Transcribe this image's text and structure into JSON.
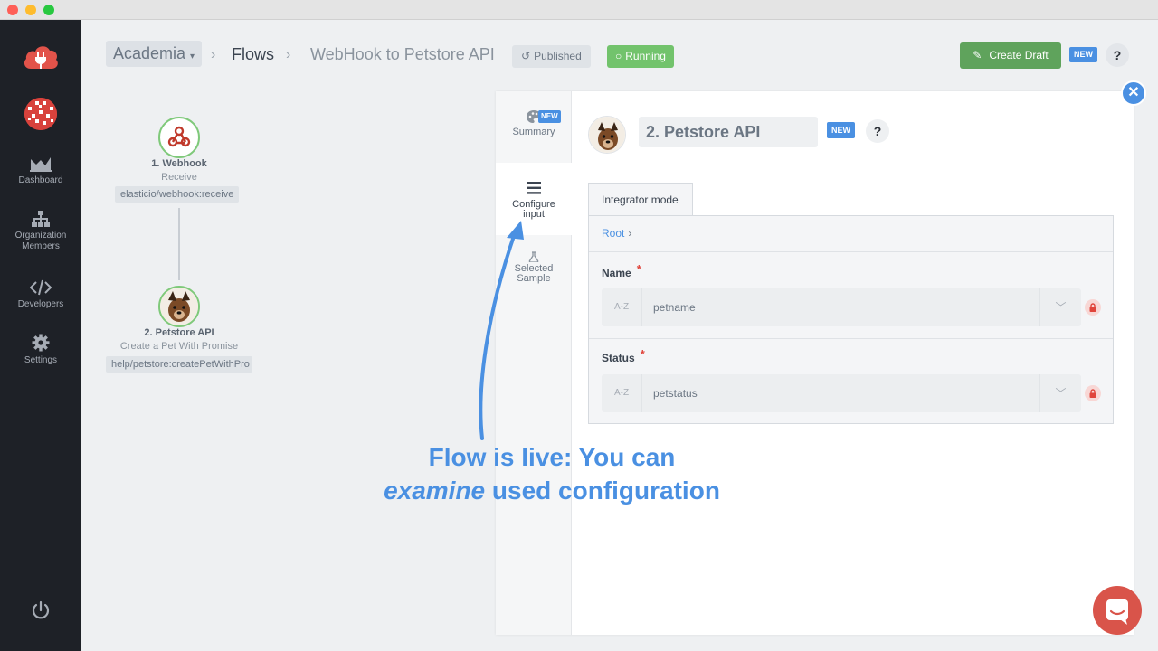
{
  "window": {
    "dots": [
      "#fe5f57",
      "#febc2e",
      "#28c840"
    ]
  },
  "sidebar": {
    "items": [
      {
        "label": "Dashboard",
        "icon": "dashboard-icon"
      },
      {
        "label": "Organization Members",
        "icon": "org-chart-icon"
      },
      {
        "label": "Developers",
        "icon": "code-icon"
      },
      {
        "label": "Settings",
        "icon": "gear-icon"
      }
    ],
    "brand_color": "#e2534a"
  },
  "header": {
    "org": "Academia",
    "flows_label": "Flows",
    "flow_name": "WebHook to Petstore API",
    "published_label": "Published",
    "running_label": "Running",
    "create_draft_label": "Create Draft",
    "new_badge": "NEW",
    "help_label": "?"
  },
  "flow": {
    "nodes": [
      {
        "title": "1. Webhook",
        "subtitle": "Receive",
        "id": "elasticio/webhook:receive"
      },
      {
        "title": "2. Petstore API",
        "subtitle": "Create a Pet With Promise",
        "id": "help/petstore:createPetWithPro"
      }
    ]
  },
  "panel": {
    "tabs": [
      {
        "label": "Summary",
        "badge": "NEW"
      },
      {
        "label": "Configure input"
      },
      {
        "label": "Selected Sample"
      }
    ],
    "step_name": "2. Petstore API",
    "step_badge": "NEW",
    "mode_tab": "Integrator mode",
    "root_label": "Root",
    "fields": [
      {
        "label": "Name",
        "required": "*",
        "type_hint": "A-Z",
        "value": "petname"
      },
      {
        "label": "Status",
        "required": "*",
        "type_hint": "A-Z",
        "value": "petstatus"
      }
    ]
  },
  "annotation": {
    "line1": "Flow is live: You can",
    "line2_em": "examine",
    "line2_rest": " used configuration",
    "color": "#4a90e2"
  }
}
